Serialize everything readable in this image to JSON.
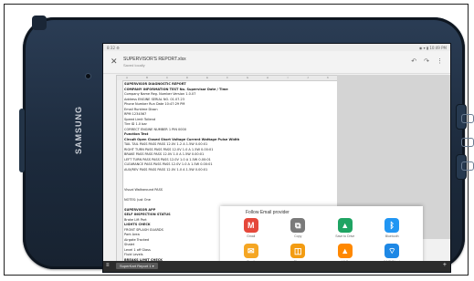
{
  "status": {
    "left": "8:32 ⚙",
    "right": "◉ ▾ ▮ 10:49 PM"
  },
  "app": {
    "close_icon": "close-icon",
    "file_title": "SUPERVISOR'S REPORT.xlsx",
    "file_sub": "Saved locally",
    "actions": [
      "↶",
      "↷",
      "⋮"
    ]
  },
  "sheet": {
    "columns": [
      "A",
      "B",
      "C",
      "D",
      "E",
      "F",
      "G",
      "H",
      "I",
      "J",
      "K"
    ],
    "rows": [
      {
        "text": "SUPERVISOR DIAGNOSTIC REPORT",
        "bold": true
      },
      {
        "text": "COMPANY INFORMATION      TEST No.        Supervisor Date / Time",
        "bold": true
      },
      {
        "text": "Company Name              Reg. Number             Version 1.0.07",
        "bold": false
      },
      {
        "text": "Address                   ENGINE SERIAL NO.        01.07.23",
        "bold": false
      },
      {
        "text": "Phone Number              Run Date                 10:47:29 PM",
        "bold": false
      },
      {
        "text": "Email                     Runtime                       Dixon",
        "bold": false
      },
      {
        "text": "                              RPM                      1234567",
        "bold": false
      },
      {
        "text": "                          Speed Limit                 Tollend",
        "bold": false
      },
      {
        "text": "                          Tire ID                      1.0 bar",
        "bold": false
      },
      {
        "text": "                          CORRECT ENGINE NUMBER         1 PIN 0000",
        "bold": false
      },
      {
        "text": "          Function Test",
        "bold": true
      },
      {
        "text": "           Circuit     Open  Closed  Short  Voltage  Current  Wattage  Pulse Width",
        "bold": true
      },
      {
        "text": "          TAIL TAIL    PASS  PASS  PASS   12.0V   1.2 A    1.5W   0.00:01",
        "bold": false
      },
      {
        "text": "          RIGHT TURN   PASS  PASS  PASS   12.0V   1.0 A    1.5W   0.00:01",
        "bold": false
      },
      {
        "text": "          BRAKE        PASS  PASS  PASS   12.0V   1.0 A    1.5W   0.00:01",
        "bold": false
      },
      {
        "text": "          LEFT TURN    PASS  PASS  PASS   12.0V   1.0 A    1.5W   0.00:01",
        "bold": false
      },
      {
        "text": "          CLEARANCE    PASS  PASS  PASS   12.0V   1.0 A    1.5W   0.00:01",
        "bold": false
      },
      {
        "text": "          AUX/REV      PASS  PASS  PASS   12.0V   1.0 A    1.5W   0.00:01",
        "bold": false
      },
      {
        "text": "",
        "bold": false
      },
      {
        "text": "",
        "bold": false
      },
      {
        "text": "",
        "bold": false
      },
      {
        "text": "                          Visual Walkaround         PASS",
        "bold": false
      },
      {
        "text": "",
        "bold": false
      },
      {
        "text": "NOTES: Just One",
        "bold": false
      },
      {
        "text": "",
        "bold": false
      },
      {
        "text": "                            SUPERVISOR APP",
        "bold": true
      },
      {
        "text": "           SELF INSPECTION STATUS",
        "bold": true
      },
      {
        "text": "              Brake Lift Part",
        "bold": false
      },
      {
        "text": "              LIGHTS CHECK",
        "bold": true
      },
      {
        "text": "              FRONT SPLASH GUARDS",
        "bold": false
      },
      {
        "text": "              Park Area",
        "bold": false
      },
      {
        "text": "              Airgate Tracked",
        "bold": false
      },
      {
        "text": "              Shalet",
        "bold": false
      },
      {
        "text": "              Level 1 off Glass",
        "bold": false
      },
      {
        "text": "              Fluid Levels",
        "bold": false
      },
      {
        "text": "              BREAKS LIMIT CHECK",
        "bold": true
      },
      {
        "text": "              Broken Parts",
        "bold": false
      }
    ]
  },
  "share": {
    "header": "Follow Email provider",
    "apps": [
      {
        "label": "Gmail",
        "icon": "gmail-icon",
        "glyph": "M",
        "color": "#e5483b"
      },
      {
        "label": "Copy",
        "icon": "copy-icon",
        "glyph": "⧉",
        "color": "#7a7a7a"
      },
      {
        "label": "Save to Drive",
        "icon": "drive-icon",
        "glyph": "▲",
        "color": "#1fa463"
      },
      {
        "label": "Bluetooth",
        "icon": "bluetooth-icon",
        "glyph": "ᛒ",
        "color": "#2196f3"
      },
      {
        "label": "Email",
        "icon": "email-icon",
        "glyph": "✉",
        "color": "#f5a623"
      },
      {
        "label": "Share",
        "icon": "share-icon",
        "glyph": "◫",
        "color": "#f39c12"
      },
      {
        "label": "VLC",
        "icon": "vlc-icon",
        "glyph": "▲",
        "color": "#ff8800"
      },
      {
        "label": "Wi-Fi Direct",
        "icon": "wifi-direct-icon",
        "glyph": "⌔",
        "color": "#1e88e5"
      }
    ]
  },
  "bottom": {
    "menu": "≡",
    "tab": "SuperKart Report 1 ▾",
    "add": "+"
  },
  "device": {
    "brand": "SAMSUNG"
  }
}
